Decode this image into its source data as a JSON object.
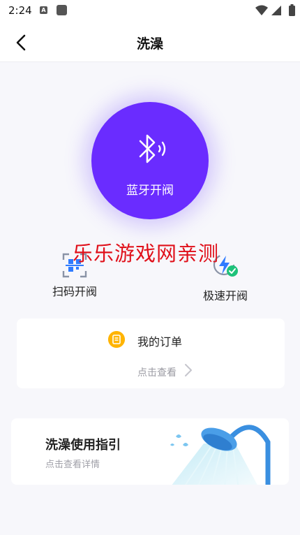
{
  "status_bar": {
    "time": "2:24",
    "notification_letter": "A"
  },
  "nav": {
    "title": "洗澡"
  },
  "bluetooth": {
    "label": "蓝牙开阀",
    "color": "#6a2cff"
  },
  "watermark": "乐乐游戏网亲测",
  "actions": [
    {
      "label": "扫码开阀",
      "icon": "qr-scan-icon"
    },
    {
      "label": "极速开阀",
      "icon": "lightning-check-icon"
    }
  ],
  "order": {
    "title": "我的订单",
    "link": "点击查看",
    "icon": "document-icon"
  },
  "guide": {
    "title": "洗澡使用指引",
    "subtitle": "点击查看详情",
    "image": "shower-head-icon"
  }
}
